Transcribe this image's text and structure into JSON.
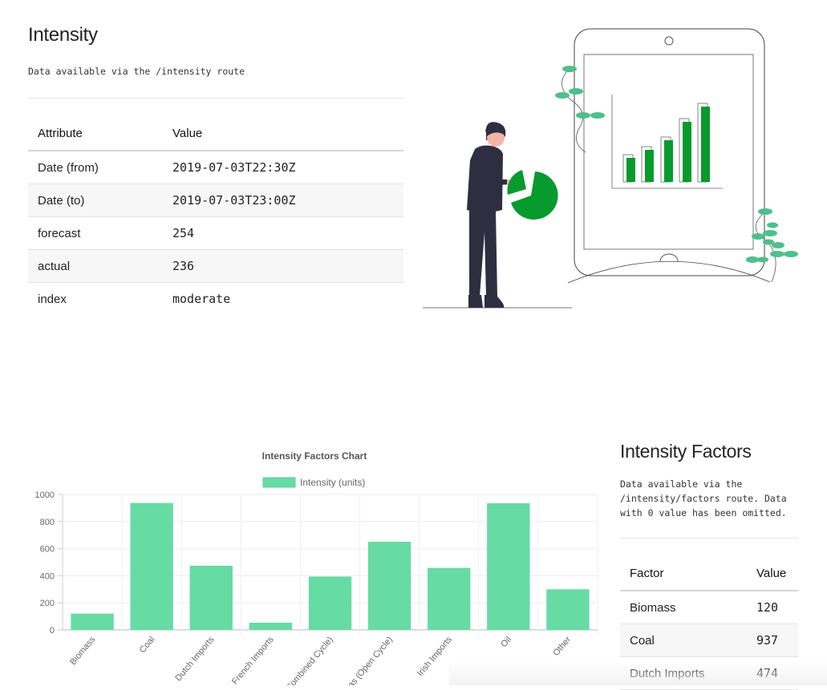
{
  "intensity": {
    "title": "Intensity",
    "description": "Data available via the /intensity route",
    "headers": [
      "Attribute",
      "Value"
    ],
    "rows": [
      {
        "attribute": "Date (from)",
        "value": "2019-07-03T22:30Z"
      },
      {
        "attribute": "Date (to)",
        "value": "2019-07-03T23:00Z"
      },
      {
        "attribute": "forecast",
        "value": "254"
      },
      {
        "attribute": "actual",
        "value": "236"
      },
      {
        "attribute": "index",
        "value": "moderate"
      }
    ]
  },
  "factors": {
    "title": "Intensity Factors",
    "description_lines": [
      "Data available via the",
      "/intensity/factors route. Data",
      "with 0 value has been omitted."
    ],
    "headers": [
      "Factor",
      "Value"
    ],
    "rows": [
      {
        "factor": "Biomass",
        "value": "120"
      },
      {
        "factor": "Coal",
        "value": "937"
      },
      {
        "factor": "Dutch Imports",
        "value": "474"
      }
    ]
  },
  "colors": {
    "bar": "#66dba3",
    "illustration_green": "#079a2d",
    "plant": "#4fbf8c"
  },
  "chart_data": {
    "type": "bar",
    "title": "Intensity Factors Chart",
    "categories": [
      "Biomass",
      "Coal",
      "Dutch Imports",
      "French Imports",
      "Gas (Combined Cycle)",
      "Gas (Open Cycle)",
      "Irish Imports",
      "Oil",
      "Other"
    ],
    "series": [
      {
        "name": "Intensity (units)",
        "values": [
          120,
          937,
          474,
          53,
          394,
          651,
          458,
          935,
          300
        ]
      }
    ],
    "ylim": [
      0,
      1000
    ],
    "yticks": [
      0,
      200,
      400,
      600,
      800,
      1000
    ],
    "grid": true,
    "legend": "top"
  }
}
